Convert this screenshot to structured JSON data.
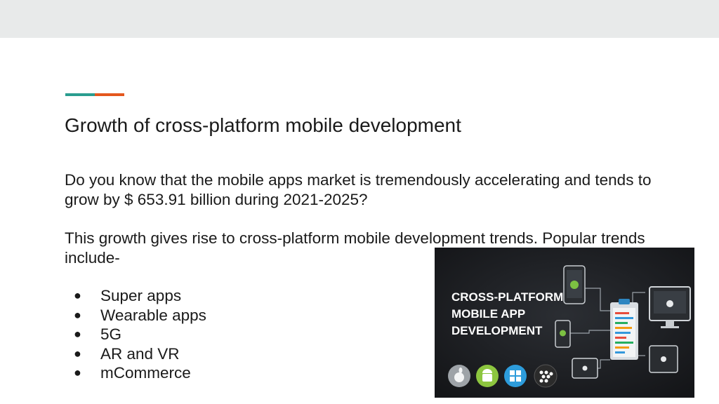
{
  "slide": {
    "title": "Growth of cross-platform mobile development",
    "paragraph1": "Do you know that the mobile apps market is tremendously accelerating and tends to grow by $ 653.91 billion during 2021-2025?",
    "paragraph2": "This growth gives rise to cross-platform mobile development trends. Popular trends include-",
    "bullet_marker": "●",
    "bullets": [
      "Super apps",
      "Wearable apps",
      "5G",
      "AR and VR",
      "mCommerce"
    ]
  },
  "promo_image": {
    "line1": "CROSS-PLATFORM",
    "line2": "MOBILE APP",
    "line3": "DEVELOPMENT",
    "icons": [
      "apple-icon",
      "android-icon",
      "windows-icon",
      "blackberry-icon"
    ]
  },
  "colors": {
    "accent_teal": "#2a9d8f",
    "accent_orange": "#e4571e",
    "top_band": "#e8eaea",
    "promo_background": "#1b1d20"
  }
}
